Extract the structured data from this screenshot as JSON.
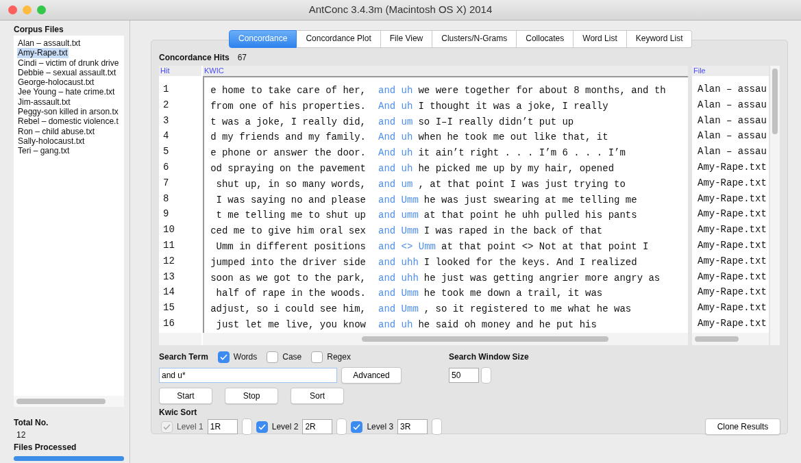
{
  "window": {
    "title": "AntConc 3.4.3m (Macintosh OS X) 2014"
  },
  "corpus_files": {
    "title": "Corpus Files",
    "items": [
      {
        "label": "Alan – assault.txt",
        "selected": false
      },
      {
        "label": "Amy-Rape.txt",
        "selected": true
      },
      {
        "label": "Cindi – victim of drunk drive",
        "selected": false
      },
      {
        "label": "Debbie – sexual assault.txt",
        "selected": false
      },
      {
        "label": "George-holocaust.txt",
        "selected": false
      },
      {
        "label": "Jee Young – hate crime.txt",
        "selected": false
      },
      {
        "label": "Jim-assault.txt",
        "selected": false
      },
      {
        "label": "Peggy-son killed in arson.tx",
        "selected": false
      },
      {
        "label": "Rebel – domestic violence.t",
        "selected": false
      },
      {
        "label": "Ron – child abuse.txt",
        "selected": false
      },
      {
        "label": "Sally-holocaust.txt",
        "selected": false
      },
      {
        "label": "Teri – gang.txt",
        "selected": false
      }
    ]
  },
  "totals": {
    "total_label": "Total No.",
    "total_value": "12",
    "processed_label": "Files Processed",
    "level": 1
  },
  "tabs": [
    {
      "label": "Concordance",
      "selected": true
    },
    {
      "label": "Concordance Plot",
      "selected": false
    },
    {
      "label": "File View",
      "selected": false
    },
    {
      "label": "Clusters/N-Grams",
      "selected": false
    },
    {
      "label": "Collocates",
      "selected": false
    },
    {
      "label": "Word List",
      "selected": false
    },
    {
      "label": "Keyword List",
      "selected": false
    }
  ],
  "hits": {
    "label": "Concordance Hits",
    "value": "67"
  },
  "table": {
    "columns": [
      "Hit",
      "KWIC",
      "File"
    ],
    "rows": [
      {
        "hit": "1",
        "left": "e home to take care of her,",
        "keyword": "and uh",
        "right": "we were together for about 8 months, and th",
        "file": "Alan – assau"
      },
      {
        "hit": "2",
        "left": "from one of his properties.",
        "keyword": "And uh",
        "right": "I thought it was a joke, I really",
        "file": "Alan – assau"
      },
      {
        "hit": "3",
        "left": "t was a joke, I really did,",
        "keyword": "and um",
        "right": "so I–I really didn’t put up",
        "file": "Alan – assau"
      },
      {
        "hit": "4",
        "left": "d my friends and my family.",
        "keyword": "And uh",
        "right": "when he took me out like that, it",
        "file": "Alan – assau"
      },
      {
        "hit": "5",
        "left": "e phone or answer the door.",
        "keyword": "And uh",
        "right": "it ain’t right . . . I’m 6 . . . I’m",
        "file": "Alan – assau"
      },
      {
        "hit": "6",
        "left": "od spraying on the pavement",
        "keyword": "and uh",
        "right": "he picked me up by my hair, opened",
        "file": "Amy-Rape.txt"
      },
      {
        "hit": "7",
        "left": "shut up, in so many words,",
        "keyword": "and um",
        "right": ", at that point I was just trying to",
        "file": "Amy-Rape.txt"
      },
      {
        "hit": "8",
        "left": "I was saying no and please",
        "keyword": "and Umm",
        "right": "he was just swearing at me telling me",
        "file": "Amy-Rape.txt"
      },
      {
        "hit": "9",
        "left": "t me telling me to shut up",
        "keyword": "and umm",
        "right": "at that point he uhh pulled his pants",
        "file": "Amy-Rape.txt"
      },
      {
        "hit": "10",
        "left": "ced me to give him oral sex",
        "keyword": "and Umm",
        "right": "I was raped in the back of that",
        "file": "Amy-Rape.txt"
      },
      {
        "hit": "11",
        "left": "Umm in different positions",
        "keyword": "and  <> Umm",
        "right": "at that point <> Not at that point I",
        "file": "Amy-Rape.txt"
      },
      {
        "hit": "12",
        "left": "jumped into the driver side",
        "keyword": "and uhh",
        "right": "I looked for the keys. And I realized",
        "file": "Amy-Rape.txt"
      },
      {
        "hit": "13",
        "left": "soon as we got to the park,",
        "keyword": "and uhh",
        "right": "he just was getting angrier more angry as",
        "file": "Amy-Rape.txt"
      },
      {
        "hit": "14",
        "left": "half of rape in the woods.",
        "keyword": "and Umm",
        "right": "he took me down a trail, it was",
        "file": "Amy-Rape.txt"
      },
      {
        "hit": "15",
        "left": "adjust, so i could see him,",
        "keyword": "and Umm",
        "right": ", so it registered to me what he was",
        "file": "Amy-Rape.txt"
      },
      {
        "hit": "16",
        "left": "just let me live, you know",
        "keyword": "and uh",
        "right": "he said oh money and he put his",
        "file": "Amy-Rape.txt"
      }
    ]
  },
  "search": {
    "label": "Search Term",
    "options": [
      {
        "label": "Words",
        "checked": true
      },
      {
        "label": "Case",
        "checked": false
      },
      {
        "label": "Regex",
        "checked": false
      }
    ],
    "value": "and u*",
    "advanced": "Advanced",
    "buttons": [
      "Start",
      "Stop",
      "Sort"
    ]
  },
  "window_size": {
    "label": "Search Window Size",
    "value": "50"
  },
  "kwic_sort": {
    "label": "Kwic Sort",
    "levels": [
      {
        "label": "Level 1",
        "checked": true,
        "disabled": true,
        "value": "1R"
      },
      {
        "label": "Level 2",
        "checked": true,
        "disabled": false,
        "value": "2R"
      },
      {
        "label": "Level 3",
        "checked": true,
        "disabled": false,
        "value": "3R"
      }
    ]
  },
  "clone": "Clone Results"
}
